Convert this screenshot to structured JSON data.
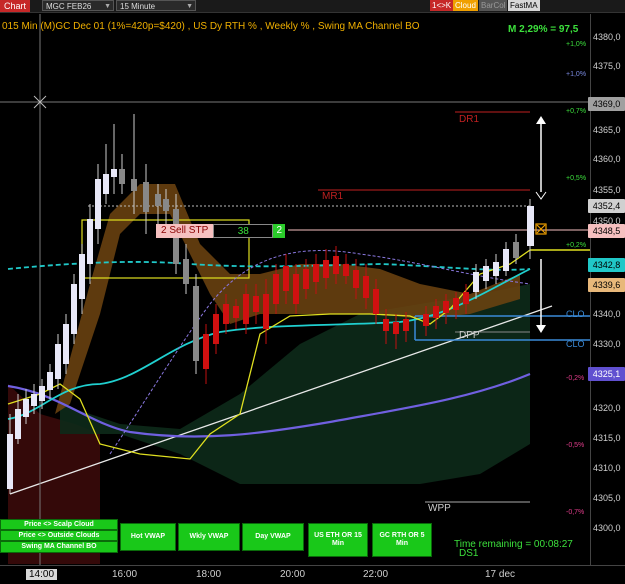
{
  "toolbar": {
    "chart_tab": "Chart",
    "symbol": "MGC FEB26",
    "interval": "15 Minute",
    "btn_kk": "1<>K",
    "btn_cloud": "Cloud",
    "btn_barcol": "BarCol",
    "btn_fastma": "FastMA"
  },
  "header": {
    "title": "015 Min  (M)GC Dec 01  (1%=420p=$420) , US Dy RTH % , Weekly % , Swing MA Channel BO",
    "mstat": "M 2,29% = 97,5"
  },
  "price_axis": {
    "labels": [
      "4380,0",
      "4375,0",
      "4370,0",
      "4365,0",
      "4360,0",
      "4355,0",
      "4350,0",
      "4345,0",
      "4340,0",
      "4335,0",
      "4330,0",
      "4325,0",
      "4320,0",
      "4315,0",
      "4310,0",
      "4305,0",
      "4300,0"
    ],
    "pct_labels": [
      "+1,0%",
      "+1,0%",
      "+0,7%",
      "+0,5%",
      "+0,2%",
      "-0,2%",
      "-0,5%",
      "-0,7%"
    ],
    "tags": [
      {
        "text": "4369,0",
        "bg": "#a0a0a0",
        "fg": "#000"
      },
      {
        "text": "4352,4",
        "bg": "#d0d0d0",
        "fg": "#000"
      },
      {
        "text": "4348,5",
        "bg": "#f6c0c0",
        "fg": "#000"
      },
      {
        "text": "4342,8",
        "bg": "#20c8c8",
        "fg": "#000"
      },
      {
        "text": "4339,6",
        "bg": "#e8b87a",
        "fg": "#000"
      },
      {
        "text": "4325,1",
        "bg": "#6050d0",
        "fg": "#fff"
      }
    ]
  },
  "time_axis": {
    "labels": [
      "14:00",
      "16:00",
      "18:00",
      "20:00",
      "22:00",
      "17 dec"
    ],
    "active": "14:00"
  },
  "levels": {
    "dr1": "DR1",
    "mr1": "MR1",
    "dpp": "DPP",
    "wpp": "WPP",
    "ds1": "DS1",
    "clo1": "CLO",
    "clo2": "CLO"
  },
  "order": {
    "label": "2  Sell STP",
    "qty": "38",
    "count": "2"
  },
  "bottom_buttons": {
    "scalp": "Price <> Scalp Cloud",
    "outside": "Price <> Outside Clouds",
    "swing": "Swing MA Channel BO",
    "hot_vwap": "Hot VWAP",
    "wkly_vwap": "Wkly VWAP",
    "day_vwap": "Day VWAP",
    "us_eth": "US ETH OR 15 Min",
    "gc_rth": "GC RTH OR 5 Min"
  },
  "status": {
    "time_remaining": "Time remaining = 00:08:27"
  },
  "colors": {
    "up_candle": "#e8e8f8",
    "down_candle": "#d01010",
    "teal": "#20d0d0",
    "purple": "#7060e0",
    "yellow": "#e0e020",
    "cloud_brown": "#7a4a10",
    "accent_green": "#19c819"
  }
}
